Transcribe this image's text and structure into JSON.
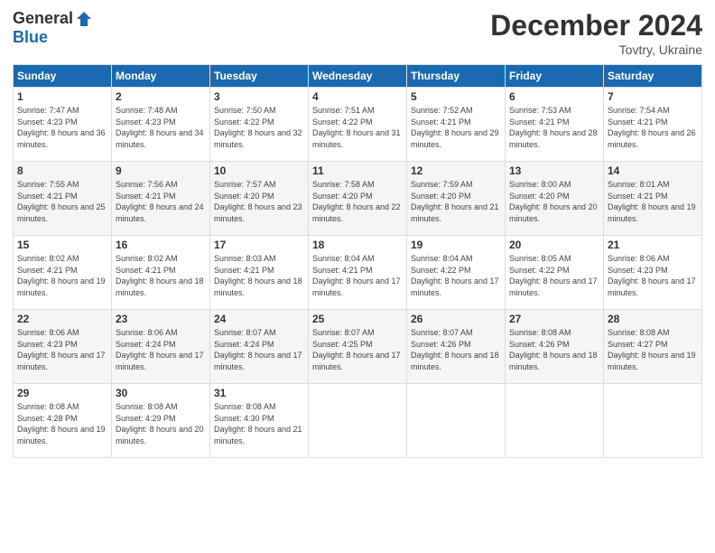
{
  "logo": {
    "general": "General",
    "blue": "Blue"
  },
  "title": "December 2024",
  "location": "Tovtry, Ukraine",
  "days_of_week": [
    "Sunday",
    "Monday",
    "Tuesday",
    "Wednesday",
    "Thursday",
    "Friday",
    "Saturday"
  ],
  "weeks": [
    [
      {
        "day": "1",
        "sunrise": "Sunrise: 7:47 AM",
        "sunset": "Sunset: 4:23 PM",
        "daylight": "Daylight: 8 hours and 36 minutes."
      },
      {
        "day": "2",
        "sunrise": "Sunrise: 7:48 AM",
        "sunset": "Sunset: 4:23 PM",
        "daylight": "Daylight: 8 hours and 34 minutes."
      },
      {
        "day": "3",
        "sunrise": "Sunrise: 7:50 AM",
        "sunset": "Sunset: 4:22 PM",
        "daylight": "Daylight: 8 hours and 32 minutes."
      },
      {
        "day": "4",
        "sunrise": "Sunrise: 7:51 AM",
        "sunset": "Sunset: 4:22 PM",
        "daylight": "Daylight: 8 hours and 31 minutes."
      },
      {
        "day": "5",
        "sunrise": "Sunrise: 7:52 AM",
        "sunset": "Sunset: 4:21 PM",
        "daylight": "Daylight: 8 hours and 29 minutes."
      },
      {
        "day": "6",
        "sunrise": "Sunrise: 7:53 AM",
        "sunset": "Sunset: 4:21 PM",
        "daylight": "Daylight: 8 hours and 28 minutes."
      },
      {
        "day": "7",
        "sunrise": "Sunrise: 7:54 AM",
        "sunset": "Sunset: 4:21 PM",
        "daylight": "Daylight: 8 hours and 26 minutes."
      }
    ],
    [
      {
        "day": "8",
        "sunrise": "Sunrise: 7:55 AM",
        "sunset": "Sunset: 4:21 PM",
        "daylight": "Daylight: 8 hours and 25 minutes."
      },
      {
        "day": "9",
        "sunrise": "Sunrise: 7:56 AM",
        "sunset": "Sunset: 4:21 PM",
        "daylight": "Daylight: 8 hours and 24 minutes."
      },
      {
        "day": "10",
        "sunrise": "Sunrise: 7:57 AM",
        "sunset": "Sunset: 4:20 PM",
        "daylight": "Daylight: 8 hours and 23 minutes."
      },
      {
        "day": "11",
        "sunrise": "Sunrise: 7:58 AM",
        "sunset": "Sunset: 4:20 PM",
        "daylight": "Daylight: 8 hours and 22 minutes."
      },
      {
        "day": "12",
        "sunrise": "Sunrise: 7:59 AM",
        "sunset": "Sunset: 4:20 PM",
        "daylight": "Daylight: 8 hours and 21 minutes."
      },
      {
        "day": "13",
        "sunrise": "Sunrise: 8:00 AM",
        "sunset": "Sunset: 4:20 PM",
        "daylight": "Daylight: 8 hours and 20 minutes."
      },
      {
        "day": "14",
        "sunrise": "Sunrise: 8:01 AM",
        "sunset": "Sunset: 4:21 PM",
        "daylight": "Daylight: 8 hours and 19 minutes."
      }
    ],
    [
      {
        "day": "15",
        "sunrise": "Sunrise: 8:02 AM",
        "sunset": "Sunset: 4:21 PM",
        "daylight": "Daylight: 8 hours and 19 minutes."
      },
      {
        "day": "16",
        "sunrise": "Sunrise: 8:02 AM",
        "sunset": "Sunset: 4:21 PM",
        "daylight": "Daylight: 8 hours and 18 minutes."
      },
      {
        "day": "17",
        "sunrise": "Sunrise: 8:03 AM",
        "sunset": "Sunset: 4:21 PM",
        "daylight": "Daylight: 8 hours and 18 minutes."
      },
      {
        "day": "18",
        "sunrise": "Sunrise: 8:04 AM",
        "sunset": "Sunset: 4:21 PM",
        "daylight": "Daylight: 8 hours and 17 minutes."
      },
      {
        "day": "19",
        "sunrise": "Sunrise: 8:04 AM",
        "sunset": "Sunset: 4:22 PM",
        "daylight": "Daylight: 8 hours and 17 minutes."
      },
      {
        "day": "20",
        "sunrise": "Sunrise: 8:05 AM",
        "sunset": "Sunset: 4:22 PM",
        "daylight": "Daylight: 8 hours and 17 minutes."
      },
      {
        "day": "21",
        "sunrise": "Sunrise: 8:06 AM",
        "sunset": "Sunset: 4:23 PM",
        "daylight": "Daylight: 8 hours and 17 minutes."
      }
    ],
    [
      {
        "day": "22",
        "sunrise": "Sunrise: 8:06 AM",
        "sunset": "Sunset: 4:23 PM",
        "daylight": "Daylight: 8 hours and 17 minutes."
      },
      {
        "day": "23",
        "sunrise": "Sunrise: 8:06 AM",
        "sunset": "Sunset: 4:24 PM",
        "daylight": "Daylight: 8 hours and 17 minutes."
      },
      {
        "day": "24",
        "sunrise": "Sunrise: 8:07 AM",
        "sunset": "Sunset: 4:24 PM",
        "daylight": "Daylight: 8 hours and 17 minutes."
      },
      {
        "day": "25",
        "sunrise": "Sunrise: 8:07 AM",
        "sunset": "Sunset: 4:25 PM",
        "daylight": "Daylight: 8 hours and 17 minutes."
      },
      {
        "day": "26",
        "sunrise": "Sunrise: 8:07 AM",
        "sunset": "Sunset: 4:26 PM",
        "daylight": "Daylight: 8 hours and 18 minutes."
      },
      {
        "day": "27",
        "sunrise": "Sunrise: 8:08 AM",
        "sunset": "Sunset: 4:26 PM",
        "daylight": "Daylight: 8 hours and 18 minutes."
      },
      {
        "day": "28",
        "sunrise": "Sunrise: 8:08 AM",
        "sunset": "Sunset: 4:27 PM",
        "daylight": "Daylight: 8 hours and 19 minutes."
      }
    ],
    [
      {
        "day": "29",
        "sunrise": "Sunrise: 8:08 AM",
        "sunset": "Sunset: 4:28 PM",
        "daylight": "Daylight: 8 hours and 19 minutes."
      },
      {
        "day": "30",
        "sunrise": "Sunrise: 8:08 AM",
        "sunset": "Sunset: 4:29 PM",
        "daylight": "Daylight: 8 hours and 20 minutes."
      },
      {
        "day": "31",
        "sunrise": "Sunrise: 8:08 AM",
        "sunset": "Sunset: 4:30 PM",
        "daylight": "Daylight: 8 hours and 21 minutes."
      },
      null,
      null,
      null,
      null
    ]
  ]
}
